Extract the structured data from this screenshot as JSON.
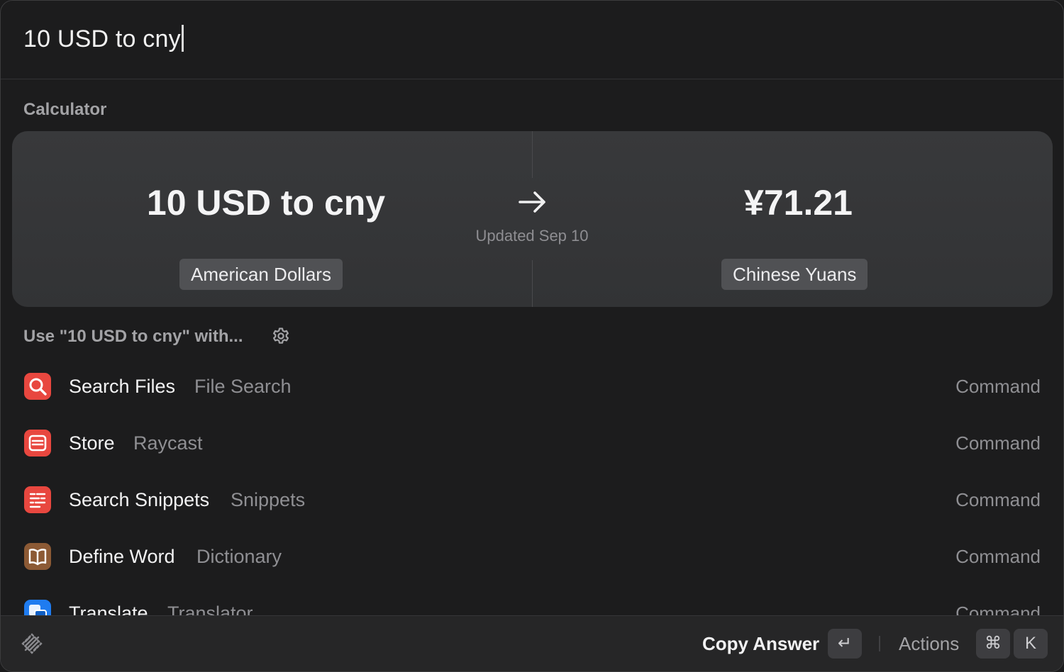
{
  "search": {
    "query": "10 USD to cny"
  },
  "calculator": {
    "section_title": "Calculator",
    "expression": "10 USD to cny",
    "result": "¥71.21",
    "updated": "Updated Sep 10",
    "from_currency": "American Dollars",
    "to_currency": "Chinese Yuans"
  },
  "fallback": {
    "section_title": "Use \"10 USD to cny\" with...",
    "items": [
      {
        "title": "Search Files",
        "subtitle": "File Search",
        "accessory": "Command",
        "icon": "magnifier-icon",
        "color": "#e8473f"
      },
      {
        "title": "Store",
        "subtitle": "Raycast",
        "accessory": "Command",
        "icon": "store-icon",
        "color": "#e8473f"
      },
      {
        "title": "Search Snippets",
        "subtitle": "Snippets",
        "accessory": "Command",
        "icon": "snippets-icon",
        "color": "#e8473f"
      },
      {
        "title": "Define Word",
        "subtitle": "Dictionary",
        "accessory": "Command",
        "icon": "book-icon",
        "color": "#8c5a35"
      },
      {
        "title": "Translate",
        "subtitle": "Translator",
        "accessory": "Command",
        "icon": "translate-icon",
        "color": "#1f7cf0"
      }
    ]
  },
  "footer": {
    "primary_action": "Copy Answer",
    "primary_key": "↵",
    "actions_label": "Actions",
    "actions_keys": [
      "⌘",
      "K"
    ]
  }
}
